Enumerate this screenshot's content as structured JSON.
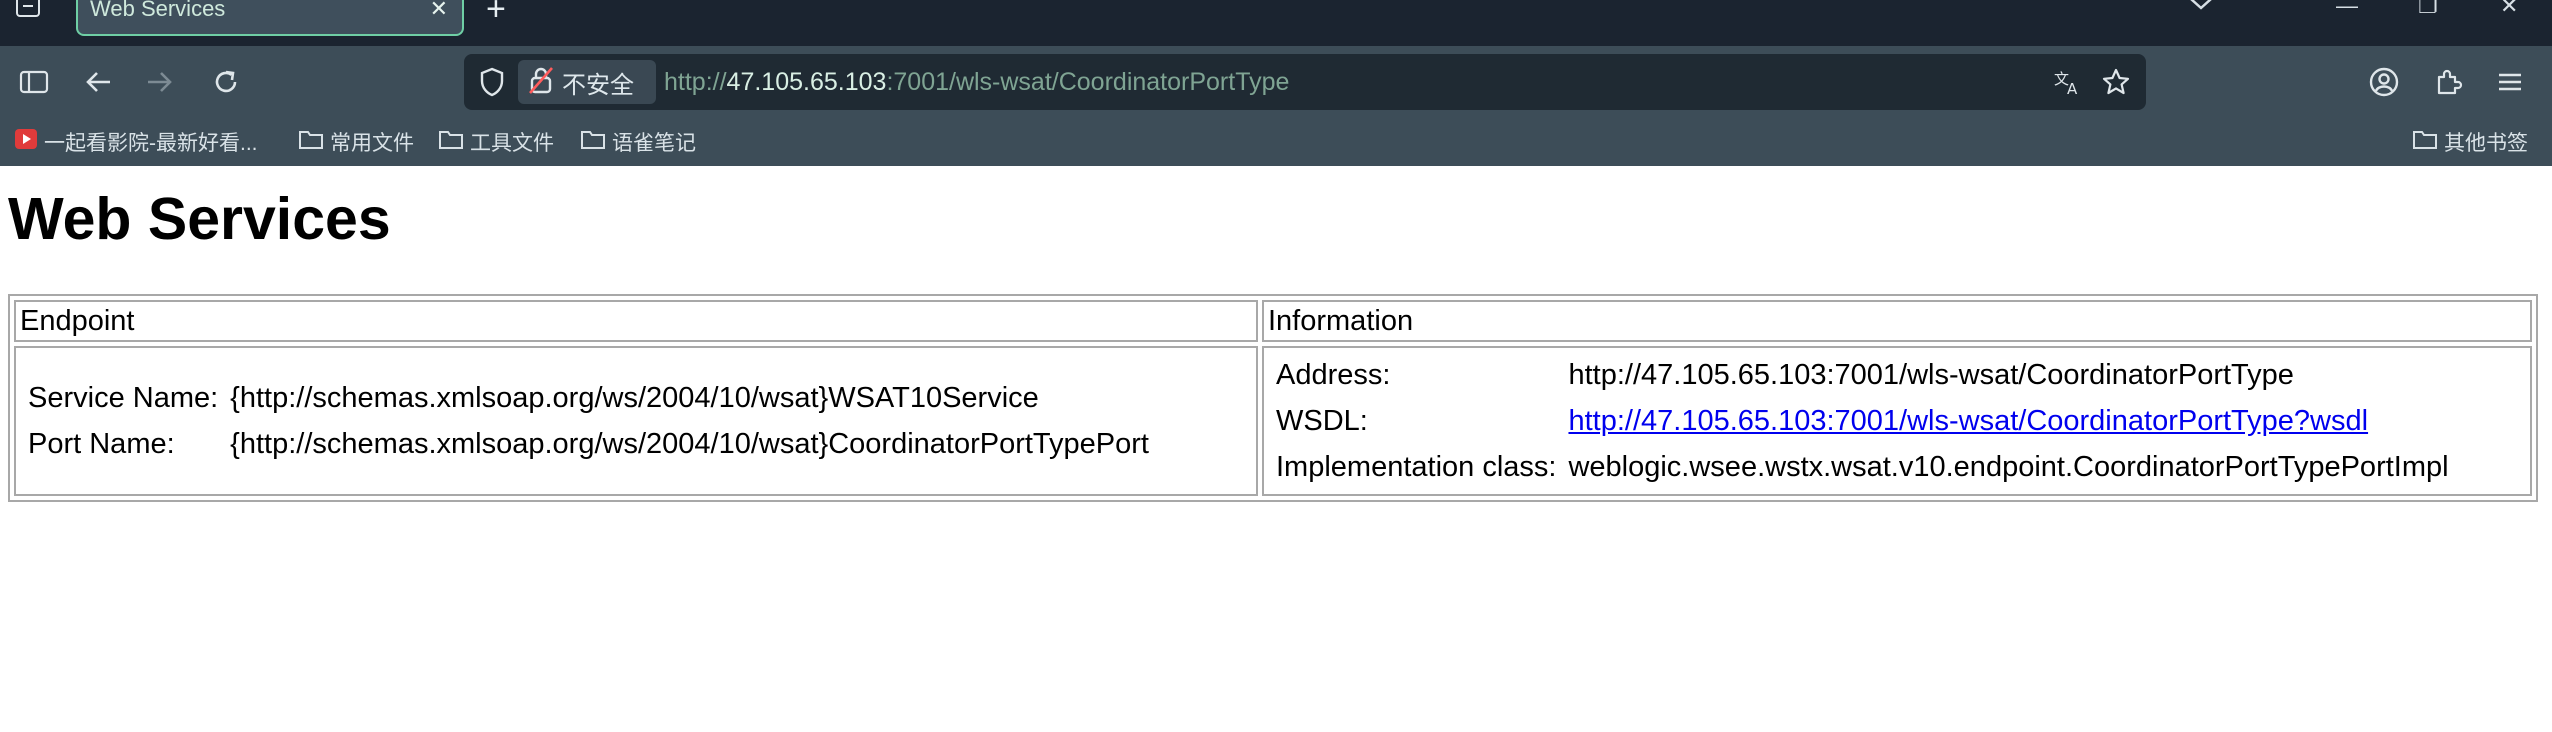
{
  "browser": {
    "tab_title": "Web Services",
    "tab_close": "✕",
    "new_tab": "+",
    "window_controls": {
      "minimize": "—",
      "maximize": "❐",
      "close": "✕"
    },
    "url": {
      "security_label": "不安全",
      "scheme": "http://",
      "host": "47.105.65.103",
      "rest": ":7001/wls-wsat/CoordinatorPortType"
    },
    "bookmarks": [
      {
        "label": "一起看影院-最新好看..."
      },
      {
        "label": "常用文件"
      },
      {
        "label": "工具文件"
      },
      {
        "label": "语雀笔记"
      }
    ],
    "other_bookmarks": "其他书签"
  },
  "page": {
    "title": "Web Services",
    "table": {
      "headers": {
        "endpoint": "Endpoint",
        "information": "Information"
      },
      "endpoint": [
        {
          "key": "Service Name:",
          "value": "{http://schemas.xmlsoap.org/ws/2004/10/wsat}WSAT10Service"
        },
        {
          "key": "Port Name:",
          "value": "{http://schemas.xmlsoap.org/ws/2004/10/wsat}CoordinatorPortTypePort"
        }
      ],
      "information": {
        "address_key": "Address:",
        "address_value": "http://47.105.65.103:7001/wls-wsat/CoordinatorPortType",
        "wsdl_key": "WSDL:",
        "wsdl_value": "http://47.105.65.103:7001/wls-wsat/CoordinatorPortType?wsdl",
        "impl_key": "Implementation class:",
        "impl_value": "weblogic.wsee.wstx.wsat.v10.endpoint.CoordinatorPortTypePortImpl"
      }
    }
  },
  "colors": {
    "tab_accent": "#6fcfa5",
    "link": "#0000ee",
    "toolbar_bg": "#3d4d58"
  }
}
